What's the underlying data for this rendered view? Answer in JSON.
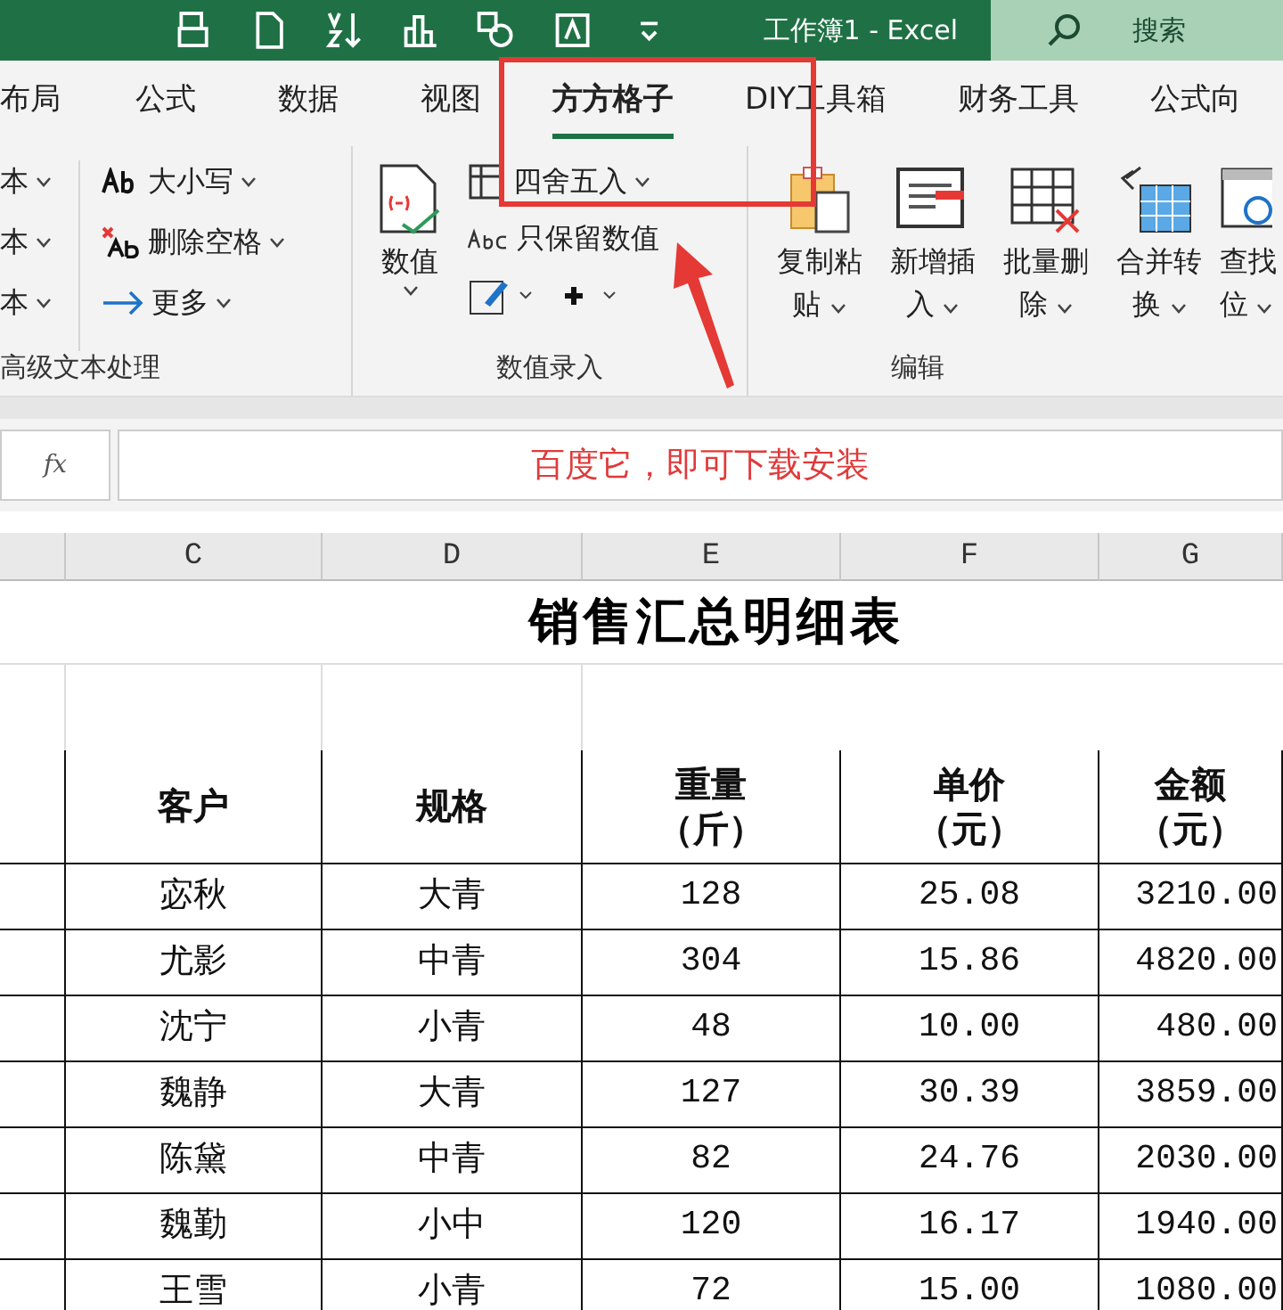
{
  "window": {
    "title": "工作簿1  -  Excel",
    "search_placeholder": "搜索"
  },
  "tabs": [
    {
      "label": "布局",
      "selected": false
    },
    {
      "label": "公式",
      "selected": false
    },
    {
      "label": "数据",
      "selected": false
    },
    {
      "label": "视图",
      "selected": false
    },
    {
      "label": "方方格子",
      "selected": true
    },
    {
      "label": "DIY工具箱",
      "selected": false
    },
    {
      "label": "财务工具",
      "selected": false
    },
    {
      "label": "公式向",
      "selected": false
    }
  ],
  "ribbon": {
    "text_group": {
      "label": "高级文本处理",
      "partial_items": [
        "本",
        "本",
        "本"
      ],
      "items": [
        {
          "kind": "case",
          "label": "大小写"
        },
        {
          "kind": "trim",
          "label": "删除空格"
        },
        {
          "kind": "more",
          "label": "更多"
        }
      ]
    },
    "value_group": {
      "label": "数值录入",
      "big_button": "数值",
      "items": [
        {
          "kind": "round",
          "label": "四舍五入"
        },
        {
          "kind": "keep",
          "label": "只保留数值"
        }
      ]
    },
    "edit_group": {
      "label": "编辑",
      "buttons": [
        {
          "kind": "copy",
          "line1": "复制粘",
          "line2": "贴"
        },
        {
          "kind": "insert",
          "line1": "新增插",
          "line2": "入"
        },
        {
          "kind": "delete",
          "line1": "批量删",
          "line2": "除"
        },
        {
          "kind": "merge",
          "line1": "合并转",
          "line2": "换"
        },
        {
          "kind": "find",
          "line1": "查找",
          "line2": "位"
        }
      ]
    }
  },
  "formula_bar": {
    "fx_label": "fx",
    "value": "百度它，即可下载安装"
  },
  "columns": [
    "C",
    "D",
    "E",
    "F",
    "G"
  ],
  "sheet": {
    "title": "销售汇总明细表",
    "headers": [
      [
        "客户"
      ],
      [
        "规格"
      ],
      [
        "重量",
        "（斤）"
      ],
      [
        "单价",
        "（元）"
      ],
      [
        "金额",
        "（元）"
      ]
    ],
    "rows": [
      [
        "宓秋",
        "大青",
        "128",
        "25.08",
        "3210.00"
      ],
      [
        "尤影",
        "中青",
        "304",
        "15.86",
        "4820.00"
      ],
      [
        "沈宁",
        "小青",
        "48",
        "10.00",
        "480.00"
      ],
      [
        "魏静",
        "大青",
        "127",
        "30.39",
        "3859.00"
      ],
      [
        "陈黛",
        "中青",
        "82",
        "24.76",
        "2030.00"
      ],
      [
        "魏勤",
        "小中",
        "120",
        "16.17",
        "1940.00"
      ],
      [
        "王雪",
        "小青",
        "72",
        "15.00",
        "1080.00"
      ]
    ]
  }
}
